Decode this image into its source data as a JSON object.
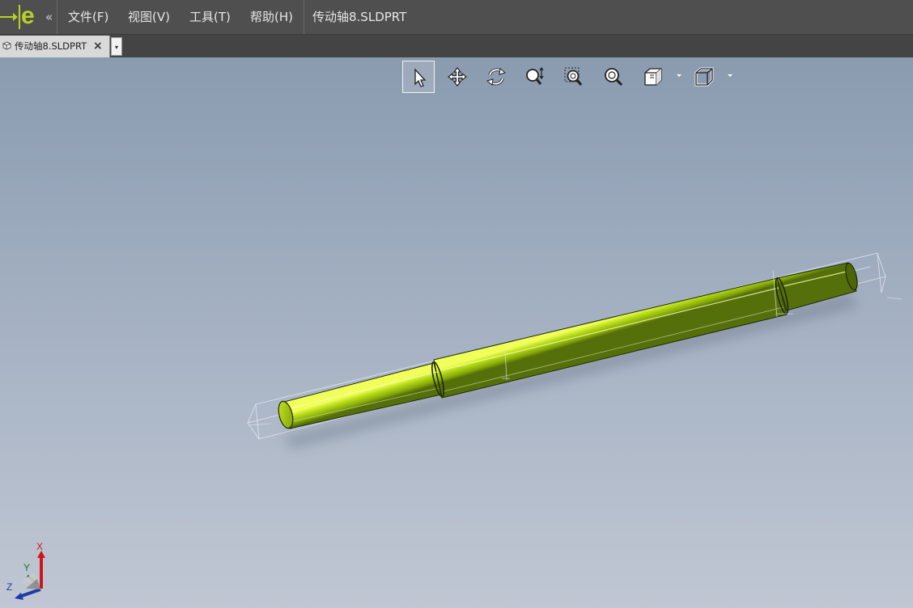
{
  "menubar": {
    "logo_letter": "e",
    "collapse_glyph": "«",
    "items": [
      {
        "label": "文件(F)"
      },
      {
        "label": "视图(V)"
      },
      {
        "label": "工具(T)"
      },
      {
        "label": "帮助(H)"
      }
    ],
    "document_title": "传动轴8.SLDPRT"
  },
  "tabs": {
    "items": [
      {
        "label": "传动轴8.SLDPRT",
        "close_glyph": "×"
      }
    ],
    "dropdown_glyph": "▾"
  },
  "toolbar": {
    "tools": [
      {
        "name": "select",
        "icon": "arrow-pointer-icon",
        "active": true
      },
      {
        "name": "pan",
        "icon": "move-arrows-icon"
      },
      {
        "name": "rotate",
        "icon": "rotate-icon"
      },
      {
        "name": "zoom",
        "icon": "zoom-updown-icon"
      },
      {
        "name": "zoom-to-area",
        "icon": "zoom-area-icon"
      },
      {
        "name": "zoom-to-fit",
        "icon": "zoom-fit-icon"
      },
      {
        "name": "display-style",
        "icon": "shaded-cube-icon",
        "has_dropdown": true
      },
      {
        "name": "view-orientation",
        "icon": "wireframe-cube-icon",
        "has_dropdown": true
      }
    ]
  },
  "triad": {
    "x_label": "X",
    "y_label": "Y",
    "z_label": "Z"
  },
  "colors": {
    "menubar_bg": "#4f4f4f",
    "accent_logo": "#b7d12a",
    "part_color": "#a4cc12",
    "viewport_top": "#8a9bb0",
    "viewport_bottom": "#c0c7d3"
  }
}
